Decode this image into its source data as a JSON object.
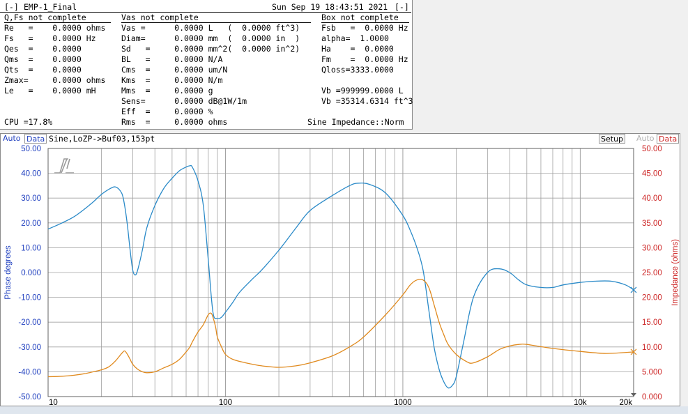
{
  "header": {
    "window_button_left": "[-]",
    "title": "EMP-1_Final",
    "datetime": "Sun Sep 19 18:43:51 2021",
    "window_button_right": "[-]",
    "sections": [
      "Q,Fs not complete",
      "Vas not complete",
      "Box not complete"
    ]
  },
  "params": {
    "col1": [
      "Re   =    0.0000 ohms",
      "Fs   =    0.0000 Hz",
      "Qes  =    0.0000",
      "Qms  =    0.0000",
      "Qts  =    0.0000",
      "Zmax=     0.0000 ohms",
      "Le   =    0.0000 mH"
    ],
    "col2": [
      "Vas =      0.0000 L   (  0.0000 ft^3)",
      "Diam=      0.0000 mm  (  0.0000 in  )",
      "Sd   =     0.0000 mm^2(  0.0000 in^2)",
      "BL   =     0.0000 N/A",
      "Cms  =     0.0000 um/N",
      "Kms  =     0.0000 N/m",
      "Mms  =     0.0000 g",
      "Sens=      0.0000 dB@1W/1m",
      "Eff  =     0.0000 %",
      "Rms  =     0.0000 ohms"
    ],
    "col3": [
      "Fsb   =  0.0000 Hz",
      "alpha=  1.0000",
      "Ha    =  0.0000",
      "Fm    =  0.0000 Hz",
      "Qloss=3333.0000",
      "Vb =999999.0000 L",
      "Vb =35314.6314 ft^3"
    ],
    "cpu": "CPU =17.8%",
    "mode": "Sine Impedance::Norm"
  },
  "graph": {
    "left_auto": "Auto",
    "left_data": "Data",
    "title": "Sine,LoZP->Buf03,153pt",
    "setup": "Setup",
    "right_auto": "Auto",
    "right_data": "Data",
    "left_label": "Phase degrees",
    "right_label": "Impedance (ohms)"
  },
  "colors": {
    "phase": "#2a8ac8",
    "impedance": "#e08a1e",
    "left_axis": "#1f3fbf",
    "right_axis": "#cc2222",
    "grid": "#a0a0a0"
  },
  "chart_data": {
    "type": "line",
    "xscale": "log",
    "xlim": [
      10,
      20000
    ],
    "x_tick_labels": [
      {
        "v": 10,
        "t": "10"
      },
      {
        "v": 100,
        "t": "100"
      },
      {
        "v": 1000,
        "t": "1000"
      },
      {
        "v": 10000,
        "t": "10k"
      },
      {
        "v": 20000,
        "t": "20k"
      }
    ],
    "y_left": {
      "label": "Phase degrees",
      "lim": [
        -50,
        50
      ],
      "ticks": [
        "50.00",
        "40.00",
        "30.00",
        "20.00",
        "10.00",
        "0.000",
        "-10.00",
        "-20.00",
        "-30.00",
        "-40.00",
        "-50.00"
      ]
    },
    "y_right": {
      "label": "Impedance (ohms)",
      "lim": [
        0,
        50
      ],
      "ticks": [
        "50.00",
        "45.00",
        "40.00",
        "35.00",
        "30.00",
        "25.00",
        "20.00",
        "15.00",
        "10.00",
        "5.000",
        "0.000"
      ]
    },
    "series": [
      {
        "axis": "left",
        "x": [
          10,
          12,
          14,
          16,
          18,
          20,
          22,
          24,
          26,
          27,
          28,
          29,
          30,
          31,
          32,
          34,
          36,
          40,
          45,
          50,
          55,
          60,
          63,
          65,
          70,
          75,
          80,
          85,
          90,
          95,
          100,
          110,
          120,
          140,
          160,
          200,
          250,
          300,
          400,
          500,
          560,
          650,
          800,
          1000,
          1100,
          1200,
          1300,
          1400,
          1500,
          1600,
          1700,
          1800,
          1900,
          2000,
          2200,
          2500,
          3000,
          3500,
          4000,
          4500,
          5000,
          6000,
          7000,
          8000,
          10000,
          12000,
          15000,
          18000,
          20000
        ],
        "y": [
          17.5,
          20,
          22.5,
          25.5,
          28.5,
          31.5,
          33.5,
          34.5,
          32,
          27,
          19,
          9,
          1,
          -1,
          1,
          9,
          18,
          27,
          34,
          38,
          41,
          42.5,
          43,
          42.5,
          37,
          27,
          5,
          -16,
          -18.5,
          -18,
          -16,
          -12,
          -8,
          -3,
          1,
          9,
          18,
          25,
          31,
          35,
          36,
          35.5,
          32,
          23,
          17,
          10,
          1,
          -15,
          -30,
          -39,
          -44,
          -46.5,
          -45.5,
          -42,
          -28,
          -10,
          0,
          1.5,
          0,
          -3,
          -5,
          -6,
          -6,
          -5,
          -4,
          -3.5,
          -3.5,
          -5,
          -7
        ]
      },
      {
        "axis": "right",
        "x": [
          10,
          12,
          14,
          16,
          18,
          20,
          22,
          24,
          26,
          27,
          28,
          29,
          30,
          32,
          34,
          36,
          40,
          45,
          50,
          55,
          60,
          63,
          65,
          70,
          75,
          80,
          83,
          85,
          88,
          90,
          95,
          100,
          110,
          130,
          160,
          200,
          250,
          300,
          400,
          500,
          600,
          800,
          1000,
          1100,
          1200,
          1300,
          1400,
          1500,
          1600,
          1700,
          1800,
          2000,
          2300,
          2500,
          3000,
          3500,
          4000,
          4500,
          5000,
          7000,
          10000,
          14000,
          20000
        ],
        "y": [
          4,
          4.1,
          4.3,
          4.6,
          5,
          5.4,
          6,
          7.2,
          8.7,
          9.2,
          8.5,
          7.5,
          6.5,
          5.5,
          5,
          4.8,
          5,
          5.8,
          6.5,
          7.5,
          9,
          10,
          11,
          13,
          14.5,
          16.5,
          16.8,
          16,
          14,
          12,
          10,
          8.5,
          7.5,
          6.8,
          6.2,
          5.9,
          6.2,
          6.8,
          8.2,
          10,
          12,
          16.5,
          20.5,
          22.5,
          23.5,
          23.5,
          22,
          18.5,
          15,
          12.5,
          10.5,
          8.5,
          7,
          6.8,
          8,
          9.5,
          10.2,
          10.5,
          10.5,
          9.7,
          9.1,
          8.7,
          9
        ]
      }
    ]
  }
}
